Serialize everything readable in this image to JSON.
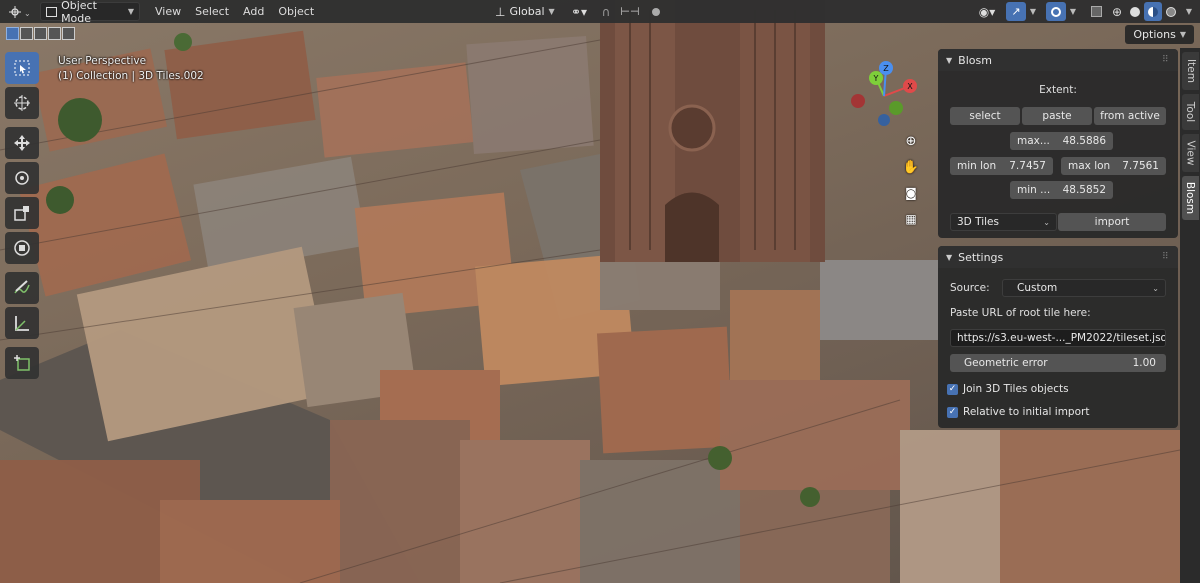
{
  "header": {
    "mode_dropdown": "Object Mode",
    "menus": [
      "View",
      "Select",
      "Add",
      "Object"
    ],
    "orientation": "Global",
    "icons": {
      "editor_type": "editor-type-icon",
      "transform_orientation": "axes-icon",
      "pivot": "link-icon",
      "snap": "magnet-icon",
      "snap_target": "snap-increment-icon",
      "proportional": "proportional-edit-icon",
      "visibility": "eye-icon",
      "gizmo": "gizmo-icon",
      "overlay": "overlay-icon",
      "xray": "xray-icon",
      "shading_wire": "wireframe-shading-icon",
      "shading_solid": "solid-shading-icon",
      "shading_material": "material-shading-icon",
      "shading_render": "rendered-shading-icon"
    }
  },
  "subbar": {
    "options_label": "Options"
  },
  "viewport": {
    "perspective": "User Perspective",
    "collection": "(1) Collection | 3D Tiles.002"
  },
  "toolbar": {
    "tools": [
      "select-box-icon",
      "cursor-icon",
      "move-icon",
      "rotate-icon",
      "scale-icon",
      "transform-icon",
      "annotate-icon",
      "measure-icon",
      "add-cube-icon"
    ]
  },
  "gizmo": {
    "x": "X",
    "y": "Y",
    "z": "Z"
  },
  "sidetabs": [
    "Item",
    "Tool",
    "View",
    "Blosm"
  ],
  "blosm_panel": {
    "title": "Blosm",
    "extent_label": "Extent:",
    "buttons": {
      "select": "select",
      "paste": "paste",
      "from_active": "from active",
      "import": "import"
    },
    "max_lat": {
      "label": "max...",
      "value": "48.5886"
    },
    "min_lon": {
      "label": "min lon",
      "value": "7.7457"
    },
    "max_lon": {
      "label": "max lon",
      "value": "7.7561"
    },
    "min_lat": {
      "label": "min ...",
      "value": "48.5852"
    },
    "data_type": "3D Tiles"
  },
  "settings_panel": {
    "title": "Settings",
    "source_label": "Source:",
    "source_value": "Custom",
    "url_label": "Paste URL of root tile here:",
    "url_value": "https://s3.eu-west-..._PM2022/tileset.json",
    "geometric_error": {
      "label": "Geometric error",
      "value": "1.00"
    },
    "join_label": "Join 3D Tiles objects",
    "relative_label": "Relative to initial import"
  }
}
